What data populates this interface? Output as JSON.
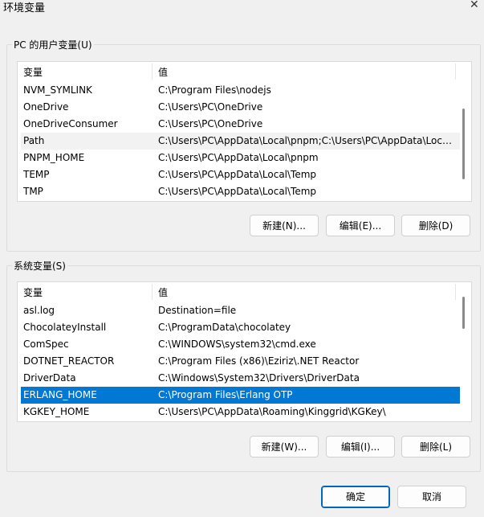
{
  "window": {
    "title": "环境变量"
  },
  "user_group": {
    "title": "PC 的用户变量(U)",
    "columns": [
      "变量",
      "值"
    ],
    "rows": [
      {
        "name": "NVM_SYMLINK",
        "value": "C:\\Program Files\\nodejs"
      },
      {
        "name": "OneDrive",
        "value": "C:\\Users\\PC\\OneDrive"
      },
      {
        "name": "OneDriveConsumer",
        "value": "C:\\Users\\PC\\OneDrive"
      },
      {
        "name": "Path",
        "value": "C:\\Users\\PC\\AppData\\Local\\pnpm;C:\\Users\\PC\\AppData\\Local\\Programs"
      },
      {
        "name": "PNPM_HOME",
        "value": "C:\\Users\\PC\\AppData\\Local\\pnpm"
      },
      {
        "name": "TEMP",
        "value": "C:\\Users\\PC\\AppData\\Local\\Temp"
      },
      {
        "name": "TMP",
        "value": "C:\\Users\\PC\\AppData\\Local\\Temp"
      }
    ],
    "buttons": {
      "new": "新建(N)...",
      "edit": "编辑(E)...",
      "delete": "删除(D)"
    }
  },
  "system_group": {
    "title": "系统变量(S)",
    "columns": [
      "变量",
      "值"
    ],
    "rows": [
      {
        "name": "asl.log",
        "value": "Destination=file"
      },
      {
        "name": "ChocolateyInstall",
        "value": "C:\\ProgramData\\chocolatey"
      },
      {
        "name": "ComSpec",
        "value": "C:\\WINDOWS\\system32\\cmd.exe"
      },
      {
        "name": "DOTNET_REACTOR",
        "value": "C:\\Program Files (x86)\\Eziriz\\.NET Reactor"
      },
      {
        "name": "DriverData",
        "value": "C:\\Windows\\System32\\Drivers\\DriverData"
      },
      {
        "name": "ERLANG_HOME",
        "value": "C:\\Program Files\\Erlang OTP"
      },
      {
        "name": "KGKEY_HOME",
        "value": "C:\\Users\\PC\\AppData\\Roaming\\Kinggrid\\KGKey\\"
      }
    ],
    "buttons": {
      "new": "新建(W)...",
      "edit": "编辑(I)...",
      "delete": "删除(L)"
    }
  },
  "footer": {
    "ok": "确定",
    "cancel": "取消"
  },
  "colors": {
    "selection": "#0078d4",
    "default_button_border": "#0067c0"
  },
  "icons": {
    "close": "close-icon"
  }
}
